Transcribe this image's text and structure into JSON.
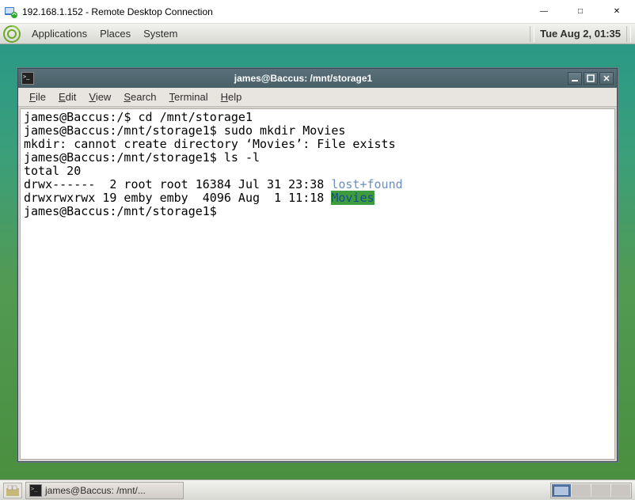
{
  "windows_titlebar": {
    "title": "192.168.1.152 - Remote Desktop Connection"
  },
  "mate_top": {
    "menus": {
      "applications": "Applications",
      "places": "Places",
      "system": "System"
    },
    "clock": "Tue Aug  2, 01:35"
  },
  "terminal_window": {
    "title": "james@Baccus: /mnt/storage1",
    "menus": {
      "file": "File",
      "edit": "Edit",
      "view": "View",
      "search": "Search",
      "terminal": "Terminal",
      "help": "Help"
    },
    "lines": {
      "l0_prompt": "james@Baccus:/$ ",
      "l0_cmd": "cd /mnt/storage1",
      "l1_prompt": "james@Baccus:/mnt/storage1$ ",
      "l1_cmd": "sudo mkdir Movies",
      "l2": "mkdir: cannot create directory ‘Movies’: File exists",
      "l3_prompt": "james@Baccus:/mnt/storage1$ ",
      "l3_cmd": "ls -l",
      "l4": "total 20",
      "l5_pre": "drwx------  2 root root 16384 Jul 31 23:38 ",
      "l5_dir": "lost+found",
      "l6_pre": "drwxrwxrwx 19 emby emby  4096 Aug  1 11:18 ",
      "l6_dir": "Movies",
      "l7_prompt": "james@Baccus:/mnt/storage1$ "
    }
  },
  "mate_bottom": {
    "task_label": "james@Baccus: /mnt/..."
  }
}
